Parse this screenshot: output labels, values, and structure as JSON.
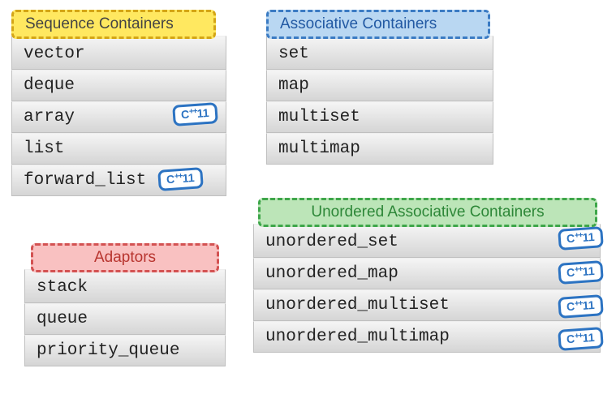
{
  "boxes": {
    "sequence": {
      "title": "Sequence Containers",
      "items": [
        {
          "label": "vector",
          "badge": null
        },
        {
          "label": "deque",
          "badge": null
        },
        {
          "label": "array",
          "badge": "C++11"
        },
        {
          "label": "list",
          "badge": null
        },
        {
          "label": "forward_list",
          "badge": "C++11"
        }
      ]
    },
    "associative": {
      "title": "Associative Containers",
      "items": [
        {
          "label": "set",
          "badge": null
        },
        {
          "label": "map",
          "badge": null
        },
        {
          "label": "multiset",
          "badge": null
        },
        {
          "label": "multimap",
          "badge": null
        }
      ]
    },
    "adaptors": {
      "title": "Adaptors",
      "items": [
        {
          "label": "stack",
          "badge": null
        },
        {
          "label": "queue",
          "badge": null
        },
        {
          "label": "priority_queue",
          "badge": null
        }
      ]
    },
    "unordered": {
      "title": "Unordered Associative Containers",
      "items": [
        {
          "label": "unordered_set",
          "badge": "C++11"
        },
        {
          "label": "unordered_map",
          "badge": "C++11"
        },
        {
          "label": "unordered_multiset",
          "badge": "C++11"
        },
        {
          "label": "unordered_multimap",
          "badge": "C++11"
        }
      ]
    }
  }
}
